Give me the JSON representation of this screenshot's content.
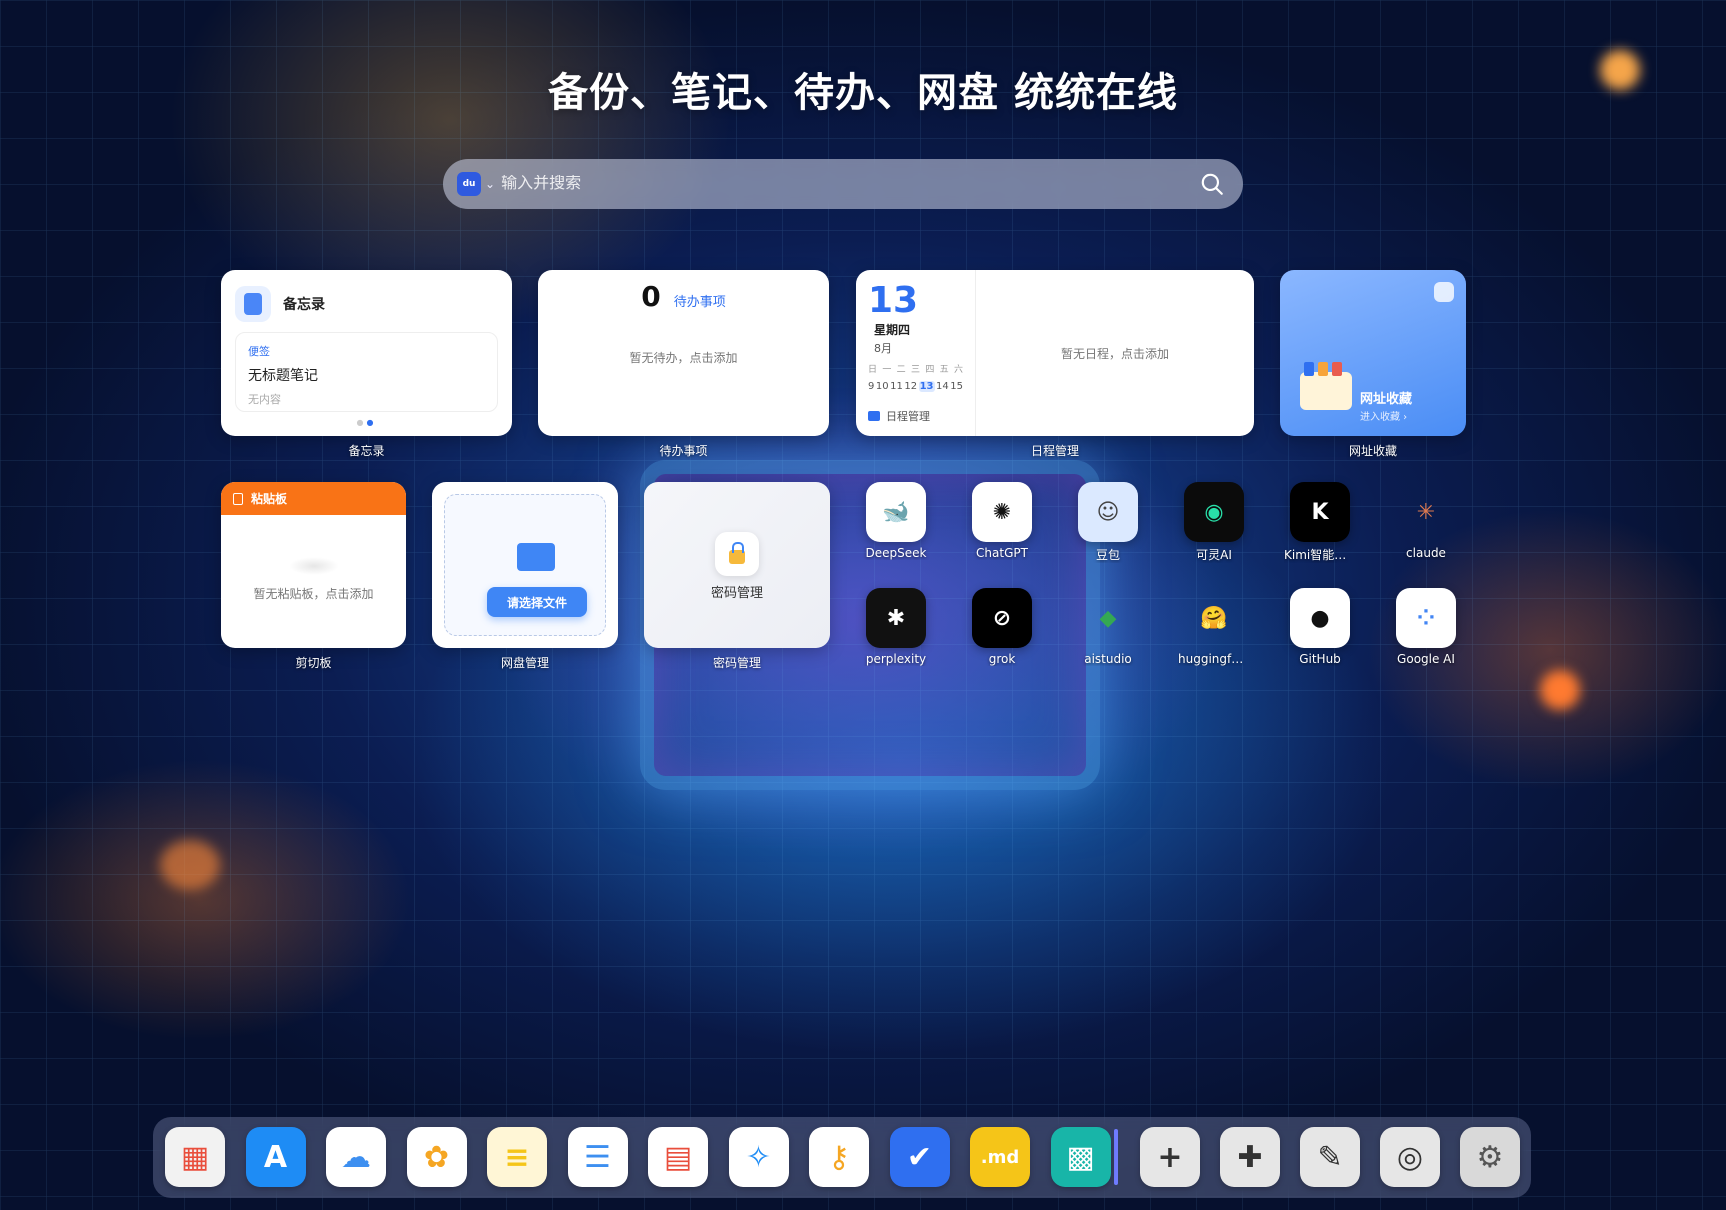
{
  "headline": "备份、笔记、待办、网盘 统统在线",
  "search": {
    "engine_icon": "baidu-icon",
    "engine_text": "du",
    "placeholder": "输入并搜索"
  },
  "memo": {
    "title": "备忘录",
    "tag": "便签",
    "note_title": "无标题笔记",
    "note_body": "无内容",
    "caption": "备忘录"
  },
  "todo": {
    "count": "0",
    "label": "待办事项",
    "empty": "暂无待办，点击添加",
    "caption": "待办事项"
  },
  "calendar": {
    "day": "13",
    "weekday": "星期四",
    "month": "8月",
    "week_header": [
      "日",
      "一",
      "二",
      "三",
      "四",
      "五",
      "六"
    ],
    "week_days": [
      "9",
      "10",
      "11",
      "12",
      "13",
      "14",
      "15"
    ],
    "today": "13",
    "footer": "日程管理",
    "empty": "暂无日程，点击添加",
    "caption": "日程管理"
  },
  "bookmarks": {
    "title": "网址收藏",
    "sub": "进入收藏 ›",
    "caption": "网址收藏"
  },
  "clipboard": {
    "title": "粘贴板",
    "empty": "暂无粘贴板，点击添加",
    "caption": "剪切板"
  },
  "disk": {
    "button": "请选择文件",
    "caption": "网盘管理"
  },
  "password": {
    "label": "密码管理",
    "caption": "密码管理"
  },
  "apps": [
    {
      "label": "DeepSeek",
      "icon": "deepseek-icon",
      "glyph": "🐋",
      "bg": "#ffffff",
      "fg": "#4d6bfe"
    },
    {
      "label": "ChatGPT",
      "icon": "chatgpt-icon",
      "glyph": "✺",
      "bg": "#ffffff",
      "fg": "#111111"
    },
    {
      "label": "豆包",
      "icon": "doubao-icon",
      "glyph": "☺",
      "bg": "#dbe9ff",
      "fg": "#444444"
    },
    {
      "label": "可灵AI",
      "icon": "kling-icon",
      "glyph": "◉",
      "bg": "#0b0b0b",
      "fg": "#29e0a9"
    },
    {
      "label": "Kimi智能助...",
      "icon": "kimi-icon",
      "glyph": "K",
      "bg": "#000000",
      "fg": "#ffffff"
    },
    {
      "label": "claude",
      "icon": "claude-icon",
      "glyph": "✳",
      "bg": "transparent",
      "fg": "#e07a4f"
    },
    {
      "label": "perplexity",
      "icon": "perplexity-icon",
      "glyph": "✱",
      "bg": "#111111",
      "fg": "#ffffff"
    },
    {
      "label": "grok",
      "icon": "grok-icon",
      "glyph": "⊘",
      "bg": "#000000",
      "fg": "#ffffff"
    },
    {
      "label": "aistudio",
      "icon": "aistudio-icon",
      "glyph": "◆",
      "bg": "transparent",
      "fg": "#34a853"
    },
    {
      "label": "huggingfa...",
      "icon": "huggingface-icon",
      "glyph": "🤗",
      "bg": "transparent",
      "fg": "#ffcc33"
    },
    {
      "label": "GitHub",
      "icon": "github-icon",
      "glyph": "●",
      "bg": "#ffffff",
      "fg": "#111111"
    },
    {
      "label": "Google AI",
      "icon": "google-ai-icon",
      "glyph": "⁘",
      "bg": "#ffffff",
      "fg": "#4285f4"
    }
  ],
  "dock": [
    {
      "icon": "launchpad-icon",
      "glyph": "▦",
      "bg": "#f2f2f2",
      "fg": "#e94e3c"
    },
    {
      "icon": "app-store-icon",
      "glyph": "A",
      "bg": "#1e8cf5",
      "fg": "#ffffff"
    },
    {
      "icon": "icloud-icon",
      "glyph": "☁",
      "bg": "#ffffff",
      "fg": "#3d8ff0"
    },
    {
      "icon": "photos-icon",
      "glyph": "✿",
      "bg": "#ffffff",
      "fg": "#f5a623"
    },
    {
      "icon": "notes-icon",
      "glyph": "≡",
      "bg": "#fff6d6",
      "fg": "#f5c518"
    },
    {
      "icon": "reminders-icon",
      "glyph": "☰",
      "bg": "#ffffff",
      "fg": "#3d8ff0"
    },
    {
      "icon": "calendar-icon",
      "glyph": "▤",
      "bg": "#ffffff",
      "fg": "#e94e3c"
    },
    {
      "icon": "safari-icon",
      "glyph": "✧",
      "bg": "#ffffff",
      "fg": "#1e8cf5"
    },
    {
      "icon": "passwords-icon",
      "glyph": "⚷",
      "bg": "#ffffff",
      "fg": "#f5a623"
    },
    {
      "icon": "checklist-icon",
      "glyph": "✔",
      "bg": "#2f6ff0",
      "fg": "#ffffff"
    },
    {
      "icon": "markdown-icon",
      "glyph": ".md",
      "bg": "#f5c518",
      "fg": "#ffffff"
    },
    {
      "icon": "qrcode-icon",
      "glyph": "▩",
      "bg": "#18b5a8",
      "fg": "#ffffff"
    },
    {
      "icon": "add-icon",
      "glyph": "+",
      "bg": "#e6e6e6",
      "fg": "#333333"
    },
    {
      "icon": "extensions-icon",
      "glyph": "✚",
      "bg": "#e6e6e6",
      "fg": "#333333"
    },
    {
      "icon": "brush-icon",
      "glyph": "✎",
      "bg": "#e6e6e6",
      "fg": "#333333"
    },
    {
      "icon": "camera-settings-icon",
      "glyph": "◎",
      "bg": "#e6e6e6",
      "fg": "#333333"
    },
    {
      "icon": "settings-icon",
      "glyph": "⚙",
      "bg": "#d9d9d9",
      "fg": "#555555"
    }
  ]
}
